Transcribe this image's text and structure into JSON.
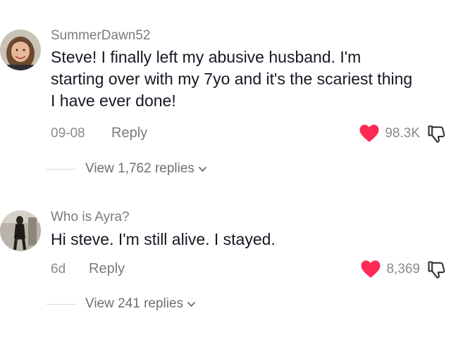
{
  "comments": [
    {
      "username": "SummerDawn52",
      "text": "Steve! I finally left my abusive husband. I'm starting over with my 7yo and it's the scariest thing I have ever done!",
      "date": "09-08",
      "reply_label": "Reply",
      "likes": "98.3K",
      "view_replies": "View 1,762 replies",
      "avatar_icon": "woman-portrait-avatar"
    },
    {
      "username": "Who is Ayra?",
      "text": "Hi steve. I'm still alive. I stayed.",
      "date": "6d",
      "reply_label": "Reply",
      "likes": "8,369",
      "view_replies": "View 241 replies",
      "avatar_icon": "dark-figure-avatar"
    }
  ],
  "colors": {
    "heart": "#fe2c55",
    "username": "#7c7c7c",
    "text": "#161823"
  }
}
